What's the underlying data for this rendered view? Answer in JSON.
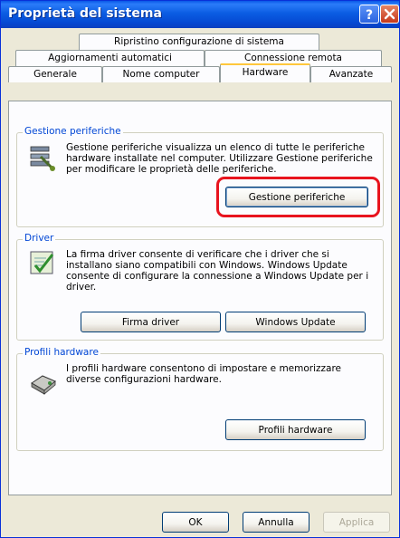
{
  "window": {
    "title": "Proprietà del sistema"
  },
  "tabs": {
    "row1": [
      {
        "label": "Ripristino configurazione di sistema"
      }
    ],
    "row2": [
      {
        "label": "Aggiornamenti automatici"
      },
      {
        "label": "Connessione remota"
      }
    ],
    "row3": [
      {
        "label": "Generale"
      },
      {
        "label": "Nome computer"
      },
      {
        "label": "Hardware"
      },
      {
        "label": "Avanzate"
      }
    ],
    "active": "Hardware"
  },
  "groups": {
    "device_manager": {
      "label": "Gestione periferiche",
      "text": "Gestione periferiche visualizza un elenco di tutte le periferiche hardware installate nel computer. Utilizzare Gestione periferiche per modificare le proprietà delle periferiche.",
      "button": "Gestione periferiche"
    },
    "driver": {
      "label": "Driver",
      "text": "La firma driver consente di verificare che i driver che si installano siano compatibili con Windows. Windows Update consente di configurare la connessione a Windows Update per i driver.",
      "button_signing": "Firma driver",
      "button_update": "Windows Update"
    },
    "profiles": {
      "label": "Profili hardware",
      "text": "I profili hardware consentono di impostare e memorizzare diverse configurazioni hardware.",
      "button": "Profili hardware"
    }
  },
  "dialog_buttons": {
    "ok": "OK",
    "cancel": "Annulla",
    "apply": "Applica"
  },
  "colors": {
    "title_bar": "#0a58e8",
    "group_label": "#0046d5",
    "highlight": "#e8141e",
    "active_tab_accent": "#ffc73c"
  },
  "icons": {
    "help": "help-icon",
    "close": "close-icon",
    "device_manager": "device-manager-icon",
    "driver": "driver-signing-icon",
    "profiles": "hardware-profile-icon"
  }
}
